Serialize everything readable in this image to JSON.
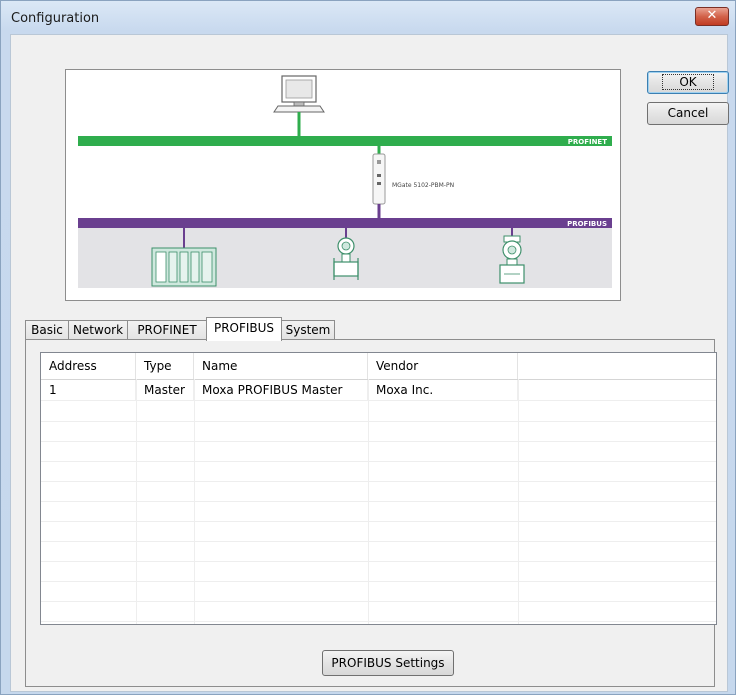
{
  "window": {
    "title": "Configuration"
  },
  "dialog": {
    "ok_label": "OK",
    "cancel_label": "Cancel"
  },
  "diagram": {
    "profinet_label": "PROFINET",
    "profibus_label": "PROFIBUS",
    "device_label": "MGate 5102-PBM-PN",
    "profinet_color": "#2fad4d",
    "profibus_color": "#6a3f8f"
  },
  "tabs": [
    {
      "label": "Basic"
    },
    {
      "label": "Network"
    },
    {
      "label": "PROFINET"
    },
    {
      "label": "PROFIBUS"
    },
    {
      "label": "System"
    }
  ],
  "active_tab": "PROFIBUS",
  "table": {
    "columns": [
      "Address",
      "Type",
      "Name",
      "Vendor",
      ""
    ],
    "rows": [
      {
        "address": "1",
        "type": "Master",
        "name": "Moxa PROFIBUS Master",
        "vendor": "Moxa Inc."
      }
    ]
  },
  "profibus_settings_label": "PROFIBUS Settings"
}
